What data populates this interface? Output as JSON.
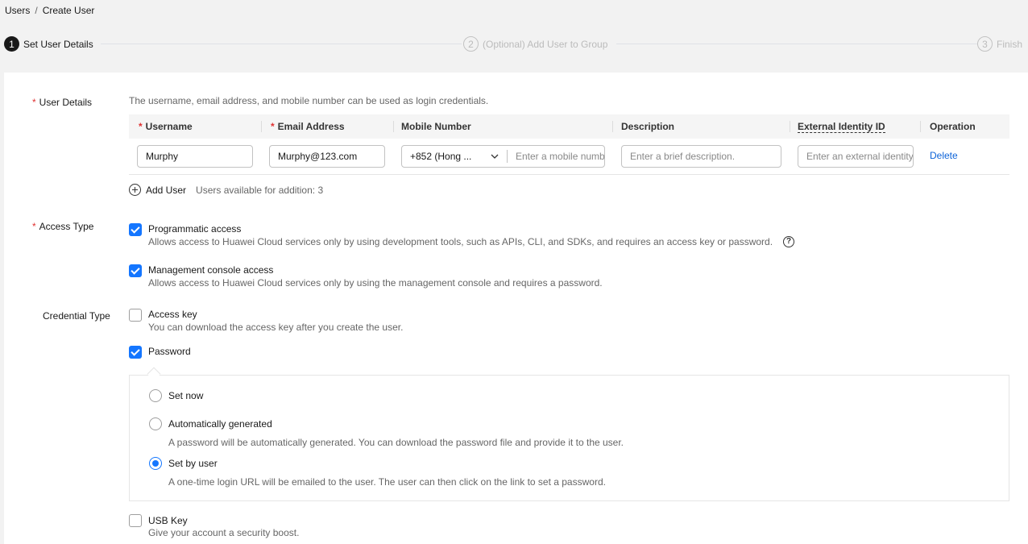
{
  "breadcrumb": {
    "parent": "Users",
    "separator": "/",
    "current": "Create User"
  },
  "steps": [
    {
      "num": "1",
      "label": "Set User Details"
    },
    {
      "num": "2",
      "label": "(Optional) Add User to Group"
    },
    {
      "num": "3",
      "label": "Finish"
    }
  ],
  "user_details": {
    "label": "User Details",
    "hint": "The username, email address, and mobile number can be used as login credentials.",
    "columns": [
      "Username",
      "Email Address",
      "Mobile Number",
      "Description",
      "External Identity ID",
      "Operation"
    ],
    "row": {
      "username": "Murphy",
      "email": "Murphy@123.com",
      "country_code": "+852 (Hong ...",
      "mobile_placeholder": "Enter a mobile number.",
      "description_placeholder": "Enter a brief description.",
      "external_id_placeholder": "Enter an external identity ID.",
      "delete": "Delete"
    },
    "add_user": "Add User",
    "available": "Users available for addition: 3"
  },
  "access_type": {
    "label": "Access Type",
    "programmatic": {
      "title": "Programmatic access",
      "desc": "Allows access to Huawei Cloud services only by using development tools, such as APIs, CLI, and SDKs, and requires an access key or password.",
      "checked": true
    },
    "console": {
      "title": "Management console access",
      "desc": "Allows access to Huawei Cloud services only by using the management console and requires a password.",
      "checked": true
    },
    "help_icon": "question-circle-icon"
  },
  "credential_type": {
    "label": "Credential Type",
    "access_key": {
      "title": "Access key",
      "desc": "You can download the access key after you create the user.",
      "checked": false
    },
    "password": {
      "title": "Password",
      "checked": true
    },
    "password_options": {
      "set_now": "Set now",
      "auto": "Automatically generated",
      "auto_desc": "A password will be automatically generated. You can download the password file and provide it to the user.",
      "by_user": "Set by user",
      "by_user_desc": "A one-time login URL will be emailed to the user. The user can then click on the link to set a password.",
      "selected": "Set by user"
    },
    "usb_key": {
      "title": "USB Key",
      "desc": "Give your account a security boost.",
      "checked": false
    }
  },
  "colors": {
    "accent": "#1476ff",
    "link": "#0d63d8",
    "required": "#e03232"
  }
}
